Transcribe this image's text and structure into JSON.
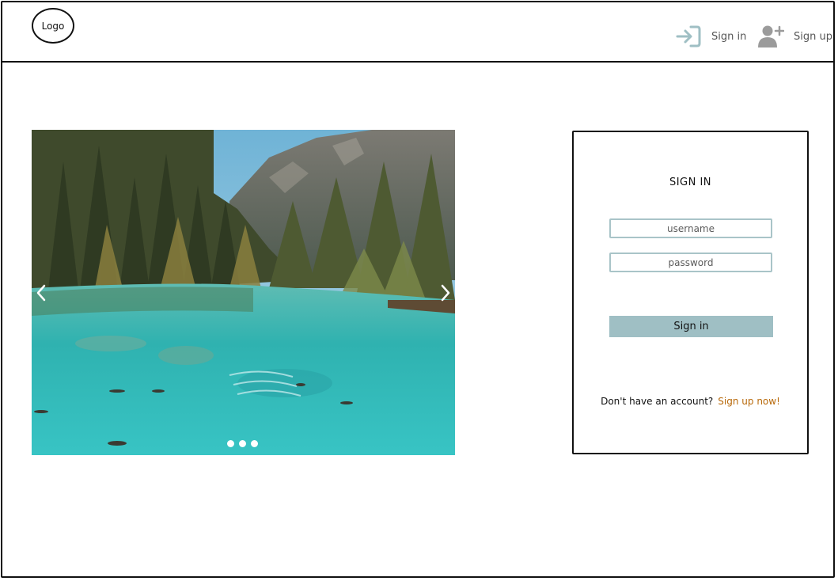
{
  "header": {
    "logo_text": "Logo",
    "signin_label": "Sign in",
    "signup_label": "Sign up"
  },
  "icons": {
    "signin": "sign-in-arrow-icon",
    "signup": "add-user-icon",
    "prev": "chevron-left-icon",
    "next": "chevron-right-icon"
  },
  "carousel": {
    "slides_count": 3,
    "active_slide": 1
  },
  "signin_form": {
    "title": "SIGN IN",
    "username_placeholder": "username",
    "password_placeholder": "password",
    "submit_label": "Sign in",
    "no_account_text": "Don't have an account?",
    "signup_link": "Sign up now!"
  },
  "colors": {
    "accent": "#9fbfc4",
    "link": "#b8690a",
    "icon": "#9fbfc4"
  }
}
